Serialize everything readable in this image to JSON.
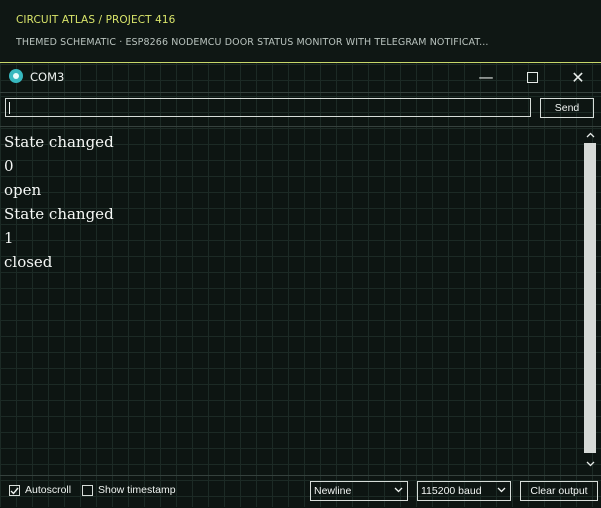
{
  "header": {
    "breadcrumb": "CIRCUIT ATLAS / PROJECT 416",
    "subtitle": "THEMED SCHEMATIC · ESP8266 NODEMCU DOOR STATUS MONITOR WITH TELEGRAM NOTIFICAT..."
  },
  "window": {
    "title": "COM3",
    "app_icon": "arduino-serial-icon",
    "controls": {
      "minimize": "—",
      "close": "✕"
    }
  },
  "send": {
    "input_value": "",
    "button_label": "Send"
  },
  "output": {
    "lines": [
      "State changed",
      "0",
      "open",
      "State changed",
      "1",
      "closed"
    ]
  },
  "status": {
    "autoscroll_label": "Autoscroll",
    "autoscroll_checked": true,
    "timestamp_label": "Show timestamp",
    "timestamp_checked": false,
    "line_ending": "Newline",
    "baud": "115200 baud",
    "clear_label": "Clear output"
  },
  "colors": {
    "background": "#0d1512",
    "accent": "#d9e56a",
    "icon": "#37b8bf"
  }
}
